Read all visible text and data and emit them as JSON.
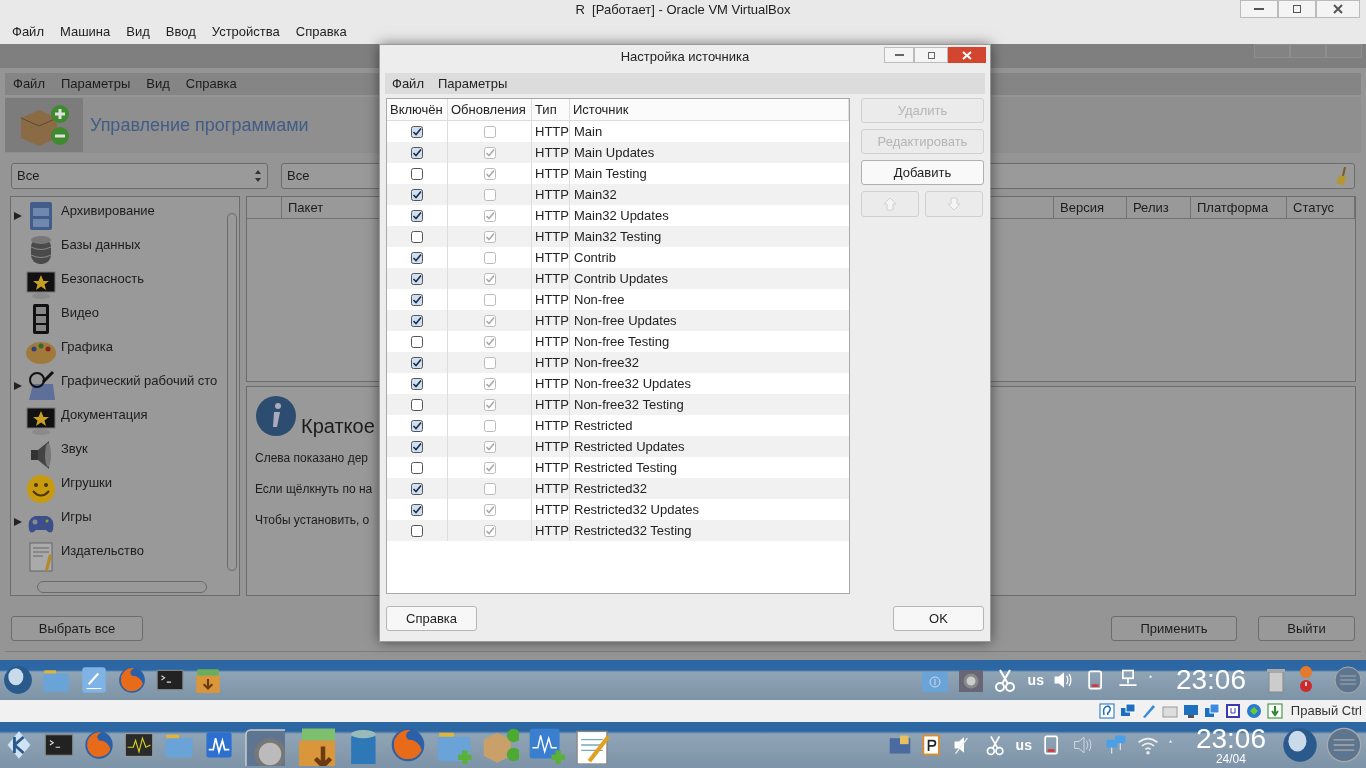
{
  "host_window": {
    "title": "R  [Работает] - Oracle VM VirtualBox",
    "menu": [
      "Файл",
      "Машина",
      "Вид",
      "Ввод",
      "Устройства",
      "Справка"
    ]
  },
  "app": {
    "menu": [
      "Файл",
      "Параметры",
      "Вид",
      "Справка"
    ],
    "header": "Управление программами",
    "filters": [
      "Все",
      "Все"
    ],
    "categories": [
      {
        "label": "Архивирование",
        "expandable": true,
        "kind": "drawer"
      },
      {
        "label": "Базы данных",
        "expandable": false,
        "kind": "database"
      },
      {
        "label": "Безопасность",
        "expandable": false,
        "kind": "star"
      },
      {
        "label": "Видео",
        "expandable": false,
        "kind": "film"
      },
      {
        "label": "Графика",
        "expandable": false,
        "kind": "palette"
      },
      {
        "label": "Графический рабочий сто",
        "expandable": true,
        "kind": "tablet"
      },
      {
        "label": "Документация",
        "expandable": false,
        "kind": "star"
      },
      {
        "label": "Звук",
        "expandable": false,
        "kind": "speaker"
      },
      {
        "label": "Игрушки",
        "expandable": false,
        "kind": "smiley"
      },
      {
        "label": "Игры",
        "expandable": true,
        "kind": "gamepad"
      },
      {
        "label": "Издательство",
        "expandable": false,
        "kind": "document"
      }
    ],
    "package_columns": [
      "Пакет",
      "Версия",
      "Релиз",
      "Платформа",
      "Статус"
    ],
    "info": {
      "title": "Краткое",
      "lines": [
        "Слева показано дер",
        "Если щёлкнуть по на",
        "Чтобы установить, о"
      ]
    },
    "select_all_button": "Выбрать все",
    "apply_button": "Применить",
    "quit_button": "Выйти"
  },
  "dialog": {
    "title": "Настройка источника",
    "menu": [
      "Файл",
      "Параметры"
    ],
    "columns": [
      "Включён",
      "Обновления",
      "Тип",
      "Источник"
    ],
    "rows": [
      {
        "enabled": true,
        "updates": false,
        "type": "HTTP",
        "source": "Main"
      },
      {
        "enabled": true,
        "updates": true,
        "type": "HTTP",
        "source": "Main Updates"
      },
      {
        "enabled": false,
        "updates": true,
        "type": "HTTP",
        "source": "Main Testing"
      },
      {
        "enabled": true,
        "updates": false,
        "type": "HTTP",
        "source": "Main32"
      },
      {
        "enabled": true,
        "updates": true,
        "type": "HTTP",
        "source": "Main32 Updates"
      },
      {
        "enabled": false,
        "updates": true,
        "type": "HTTP",
        "source": "Main32 Testing"
      },
      {
        "enabled": true,
        "updates": false,
        "type": "HTTP",
        "source": "Contrib"
      },
      {
        "enabled": true,
        "updates": true,
        "type": "HTTP",
        "source": "Contrib Updates"
      },
      {
        "enabled": true,
        "updates": false,
        "type": "HTTP",
        "source": "Non-free"
      },
      {
        "enabled": true,
        "updates": true,
        "type": "HTTP",
        "source": "Non-free Updates"
      },
      {
        "enabled": false,
        "updates": true,
        "type": "HTTP",
        "source": "Non-free Testing"
      },
      {
        "enabled": true,
        "updates": false,
        "type": "HTTP",
        "source": "Non-free32"
      },
      {
        "enabled": true,
        "updates": true,
        "type": "HTTP",
        "source": "Non-free32 Updates"
      },
      {
        "enabled": false,
        "updates": true,
        "type": "HTTP",
        "source": "Non-free32 Testing"
      },
      {
        "enabled": true,
        "updates": false,
        "type": "HTTP",
        "source": "Restricted"
      },
      {
        "enabled": true,
        "updates": true,
        "type": "HTTP",
        "source": "Restricted Updates"
      },
      {
        "enabled": false,
        "updates": true,
        "type": "HTTP",
        "source": "Restricted Testing"
      },
      {
        "enabled": true,
        "updates": false,
        "type": "HTTP",
        "source": "Restricted32"
      },
      {
        "enabled": true,
        "updates": true,
        "type": "HTTP",
        "source": "Restricted32 Updates"
      },
      {
        "enabled": false,
        "updates": true,
        "type": "HTTP",
        "source": "Restricted32 Testing"
      }
    ],
    "side_buttons": [
      {
        "label": "Удалить",
        "disabled": true
      },
      {
        "label": "Редактировать",
        "disabled": true
      },
      {
        "label": "Добавить",
        "disabled": false
      }
    ],
    "move_buttons": [
      {
        "kind": "up",
        "disabled": true
      },
      {
        "kind": "down",
        "disabled": true
      }
    ],
    "help_button": "Справка",
    "ok_button": "OK"
  },
  "guest_panel": {
    "keyboard": "us",
    "clock": "23:06"
  },
  "vbox_status": {
    "host_key": "Правый Ctrl"
  },
  "host_panel": {
    "keyboard": "us",
    "clock": "23:06",
    "date": "24/04"
  }
}
